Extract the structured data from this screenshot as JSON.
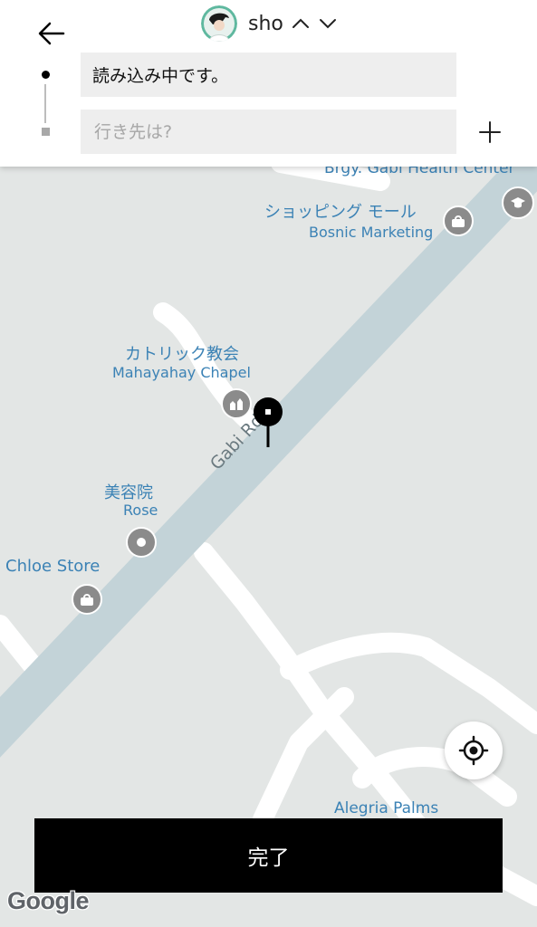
{
  "header": {
    "profile_name": "sho",
    "origin_text": "読み込み中です。",
    "destination_placeholder": "行き先は?",
    "destination_value": ""
  },
  "map": {
    "road_label": "Gabi Rd",
    "pois": {
      "health_center": "Brgy. Gabi Health Center",
      "shopping_mall_jp": "ショッピング モール",
      "shopping_mall_en": "Bosnic Marketing",
      "church_jp": "カトリック教会",
      "church_en": "Mahayahay Chapel",
      "salon_jp": "美容院",
      "salon_en": "Rose",
      "store": "Chloe Store",
      "alegria": "Alegria Palms"
    },
    "attribution": "Google"
  },
  "actions": {
    "done_label": "完了"
  },
  "icons": {
    "back": "arrow-left-icon",
    "chevron_up": "chevron-up-icon",
    "chevron_down": "chevron-down-icon",
    "add": "plus-icon",
    "locate": "crosshair-icon",
    "pin": "map-pin-icon"
  },
  "colors": {
    "map_bg": "#e3e6e5",
    "road_main": "#c3d3d8",
    "poi_label": "#3b82b5",
    "poi_icon": "#8b8b8b",
    "button_bg": "#000000"
  }
}
